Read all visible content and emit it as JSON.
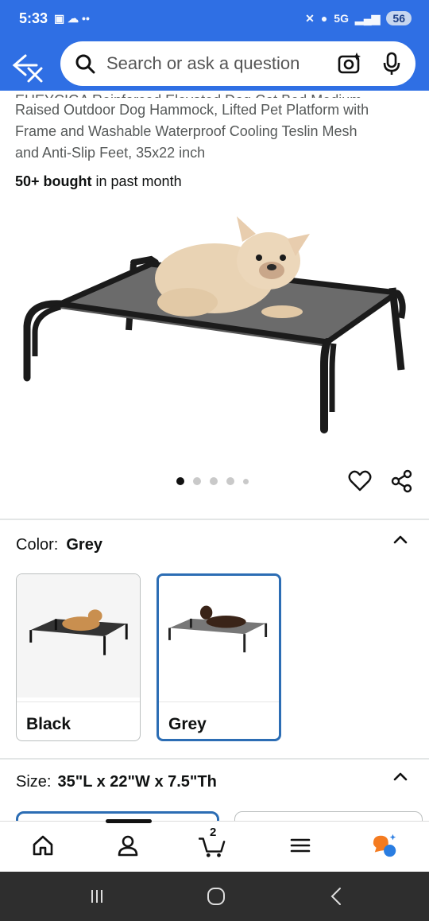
{
  "status_bar": {
    "time": "5:33",
    "network": "5G",
    "battery": "56"
  },
  "search": {
    "placeholder": "Search or ask a question"
  },
  "product": {
    "title_cut_line": "EHEYCIGA Reinforced Elevated Dog Cot Bed Medium,",
    "title_line_1": "Raised Outdoor Dog Hammock, Lifted Pet Platform with",
    "title_line_2": "Frame and Washable Waterproof Cooling Teslin Mesh",
    "title_line_3": "and Anti-Slip Feet, 35x22 inch",
    "bought_bold": "50+ bought",
    "bought_rest": " in past month",
    "image_count": 5,
    "active_image": 1
  },
  "color": {
    "label": "Color:",
    "selected": "Grey",
    "options": [
      {
        "label": "Black",
        "selected": false
      },
      {
        "label": "Grey",
        "selected": true
      }
    ]
  },
  "size": {
    "label": "Size:",
    "selected": "35\"L x 22\"W x 7.5\"Th"
  },
  "bottom_nav": {
    "items": [
      "home-icon",
      "account-icon",
      "cart-icon",
      "menu-icon",
      "rufus-icon"
    ],
    "cart_count": "2"
  },
  "colors": {
    "header": "#2f6fe4",
    "selected_border": "#2c6db4",
    "rufus_orange": "#f47b20",
    "rufus_blue": "#2a7de1"
  }
}
